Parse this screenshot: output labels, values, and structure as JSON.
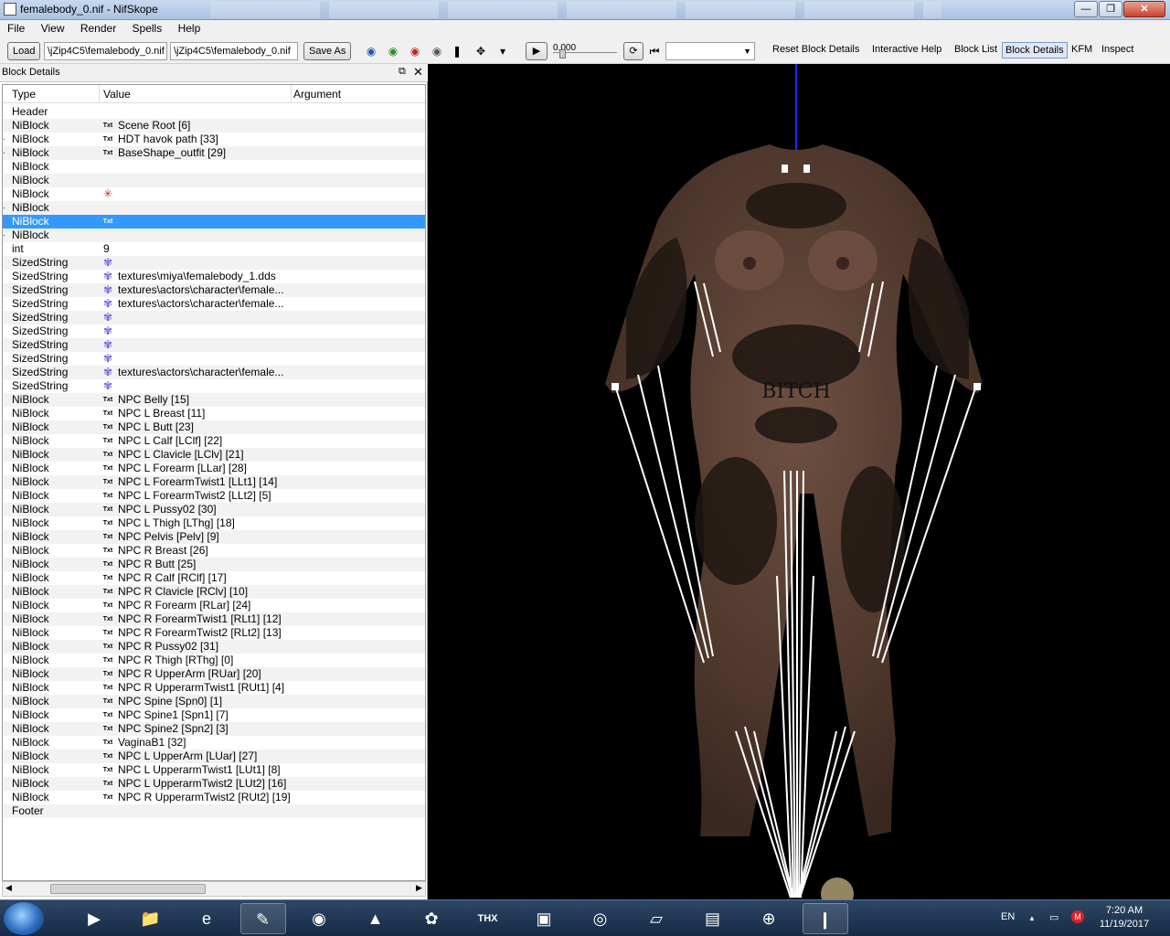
{
  "window": {
    "title": "femalebody_0.nif - NifSkope",
    "minimize": "—",
    "maximize": "❐",
    "close": "✕"
  },
  "menu": [
    "File",
    "View",
    "Render",
    "Spells",
    "Help"
  ],
  "toolbar": {
    "load_label": "Load",
    "load_path": "\\jZip4C5\\femalebody_0.nif",
    "save_path": "\\jZip4C5\\femalebody_0.nif",
    "save_as_label": "Save As",
    "time_value": "0.000",
    "reset_label": "Reset Block Details",
    "help_label": "Interactive Help",
    "block_list_label": "Block List",
    "block_details_label": "Block Details",
    "kfm_label": "KFM",
    "inspect_label": "Inspect"
  },
  "panel": {
    "title": "Block Details",
    "float_icon": "⧉",
    "close_icon": "✕",
    "columns": [
      "Type",
      "Value",
      "Argument"
    ],
    "rows": [
      {
        "type": "Header",
        "icon": "",
        "value": "",
        "exp": ""
      },
      {
        "type": "NiBlock",
        "icon": "txt",
        "value": "Scene Root [6]",
        "exp": ""
      },
      {
        "type": "NiBlock",
        "icon": "txt",
        "value": "HDT havok path [33]",
        "exp": "·"
      },
      {
        "type": "NiBlock",
        "icon": "txt",
        "value": "BaseShape_outfit [29]",
        "exp": "·"
      },
      {
        "type": "NiBlock",
        "icon": "",
        "value": "",
        "exp": ""
      },
      {
        "type": "NiBlock",
        "icon": "",
        "value": "",
        "exp": ""
      },
      {
        "type": "NiBlock",
        "icon": "star",
        "value": "",
        "exp": ""
      },
      {
        "type": "NiBlock",
        "icon": "",
        "value": "",
        "exp": "·"
      },
      {
        "type": "NiBlock",
        "icon": "txt",
        "value": "",
        "exp": "",
        "selected": true
      },
      {
        "type": "NiBlock",
        "icon": "",
        "value": "",
        "exp": "·"
      },
      {
        "type": "int",
        "icon": "",
        "value": "9",
        "exp": "",
        "plain": true
      },
      {
        "type": "SizedString",
        "icon": "flower",
        "value": "",
        "exp": ""
      },
      {
        "type": "SizedString",
        "icon": "flower",
        "value": "textures\\miya\\femalebody_1.dds",
        "exp": ""
      },
      {
        "type": "SizedString",
        "icon": "flower",
        "value": "textures\\actors\\character\\female...",
        "exp": ""
      },
      {
        "type": "SizedString",
        "icon": "flower",
        "value": "textures\\actors\\character\\female...",
        "exp": ""
      },
      {
        "type": "SizedString",
        "icon": "flower",
        "value": "",
        "exp": ""
      },
      {
        "type": "SizedString",
        "icon": "flower",
        "value": "",
        "exp": ""
      },
      {
        "type": "SizedString",
        "icon": "flower",
        "value": "",
        "exp": ""
      },
      {
        "type": "SizedString",
        "icon": "flower",
        "value": "",
        "exp": ""
      },
      {
        "type": "SizedString",
        "icon": "flower",
        "value": "textures\\actors\\character\\female...",
        "exp": ""
      },
      {
        "type": "SizedString",
        "icon": "flower",
        "value": "",
        "exp": ""
      },
      {
        "type": "NiBlock",
        "icon": "txt",
        "value": "NPC Belly [15]",
        "exp": ""
      },
      {
        "type": "NiBlock",
        "icon": "txt",
        "value": "NPC L Breast [11]",
        "exp": ""
      },
      {
        "type": "NiBlock",
        "icon": "txt",
        "value": "NPC L Butt [23]",
        "exp": ""
      },
      {
        "type": "NiBlock",
        "icon": "txt",
        "value": "NPC L Calf [LClf] [22]",
        "exp": ""
      },
      {
        "type": "NiBlock",
        "icon": "txt",
        "value": "NPC L Clavicle [LClv] [21]",
        "exp": ""
      },
      {
        "type": "NiBlock",
        "icon": "txt",
        "value": "NPC L Forearm [LLar] [28]",
        "exp": ""
      },
      {
        "type": "NiBlock",
        "icon": "txt",
        "value": "NPC L ForearmTwist1 [LLt1] [14]",
        "exp": ""
      },
      {
        "type": "NiBlock",
        "icon": "txt",
        "value": "NPC L ForearmTwist2 [LLt2] [5]",
        "exp": ""
      },
      {
        "type": "NiBlock",
        "icon": "txt",
        "value": "NPC L Pussy02 [30]",
        "exp": ""
      },
      {
        "type": "NiBlock",
        "icon": "txt",
        "value": "NPC L Thigh [LThg] [18]",
        "exp": ""
      },
      {
        "type": "NiBlock",
        "icon": "txt",
        "value": "NPC Pelvis [Pelv] [9]",
        "exp": ""
      },
      {
        "type": "NiBlock",
        "icon": "txt",
        "value": "NPC R Breast [26]",
        "exp": ""
      },
      {
        "type": "NiBlock",
        "icon": "txt",
        "value": "NPC R Butt [25]",
        "exp": ""
      },
      {
        "type": "NiBlock",
        "icon": "txt",
        "value": "NPC R Calf [RClf] [17]",
        "exp": ""
      },
      {
        "type": "NiBlock",
        "icon": "txt",
        "value": "NPC R Clavicle [RClv] [10]",
        "exp": ""
      },
      {
        "type": "NiBlock",
        "icon": "txt",
        "value": "NPC R Forearm [RLar] [24]",
        "exp": ""
      },
      {
        "type": "NiBlock",
        "icon": "txt",
        "value": "NPC R ForearmTwist1 [RLt1] [12]",
        "exp": ""
      },
      {
        "type": "NiBlock",
        "icon": "txt",
        "value": "NPC R ForearmTwist2 [RLt2] [13]",
        "exp": ""
      },
      {
        "type": "NiBlock",
        "icon": "txt",
        "value": "NPC R Pussy02 [31]",
        "exp": ""
      },
      {
        "type": "NiBlock",
        "icon": "txt",
        "value": "NPC R Thigh [RThg] [0]",
        "exp": ""
      },
      {
        "type": "NiBlock",
        "icon": "txt",
        "value": "NPC R UpperArm [RUar] [20]",
        "exp": ""
      },
      {
        "type": "NiBlock",
        "icon": "txt",
        "value": "NPC R UpperarmTwist1 [RUt1] [4]",
        "exp": ""
      },
      {
        "type": "NiBlock",
        "icon": "txt",
        "value": "NPC Spine [Spn0] [1]",
        "exp": ""
      },
      {
        "type": "NiBlock",
        "icon": "txt",
        "value": "NPC Spine1 [Spn1] [7]",
        "exp": ""
      },
      {
        "type": "NiBlock",
        "icon": "txt",
        "value": "NPC Spine2 [Spn2] [3]",
        "exp": ""
      },
      {
        "type": "NiBlock",
        "icon": "txt",
        "value": "VaginaB1 [32]",
        "exp": ""
      },
      {
        "type": "NiBlock",
        "icon": "txt",
        "value": "NPC L UpperArm [LUar] [27]",
        "exp": ""
      },
      {
        "type": "NiBlock",
        "icon": "txt",
        "value": "NPC L UpperarmTwist1 [LUt1] [8]",
        "exp": ""
      },
      {
        "type": "NiBlock",
        "icon": "txt",
        "value": "NPC L UpperarmTwist2 [LUt2] [16]",
        "exp": ""
      },
      {
        "type": "NiBlock",
        "icon": "txt",
        "value": "NPC R UpperarmTwist2 [RUt2] [19]",
        "exp": ""
      },
      {
        "type": "Footer",
        "icon": "",
        "value": "",
        "exp": ""
      }
    ]
  },
  "icon_labels": {
    "txt": "Txt",
    "flower": "✾",
    "star": "✳"
  },
  "viewport": {
    "tattoo_text": "BITCH",
    "skin_color": "#5a4034",
    "bone_line_color": "#ffffff",
    "axis_color": "#1a2cff"
  },
  "taskbar": {
    "lang": "EN",
    "tray_up": "▲",
    "time": "7:20 AM",
    "date": "11/19/2017",
    "apps": [
      {
        "name": "media-player-icon",
        "glyph": "▶"
      },
      {
        "name": "explorer-icon",
        "glyph": "📁"
      },
      {
        "name": "internet-explorer-icon",
        "glyph": "e"
      },
      {
        "name": "nifskope-icon",
        "glyph": "✎",
        "active": true
      },
      {
        "name": "firefox-icon",
        "glyph": "◉"
      },
      {
        "name": "vlc-icon",
        "glyph": "▲"
      },
      {
        "name": "gimp-icon",
        "glyph": "✿"
      },
      {
        "name": "thx-icon",
        "glyph": "THX"
      },
      {
        "name": "monitor-icon",
        "glyph": "▣"
      },
      {
        "name": "chrome-icon",
        "glyph": "◎"
      },
      {
        "name": "notepad-icon",
        "glyph": "▱"
      },
      {
        "name": "task-manager-icon",
        "glyph": "▤"
      },
      {
        "name": "network-icon",
        "glyph": "⊕"
      },
      {
        "name": "body-editor-icon",
        "glyph": "❙",
        "active": true
      }
    ]
  }
}
